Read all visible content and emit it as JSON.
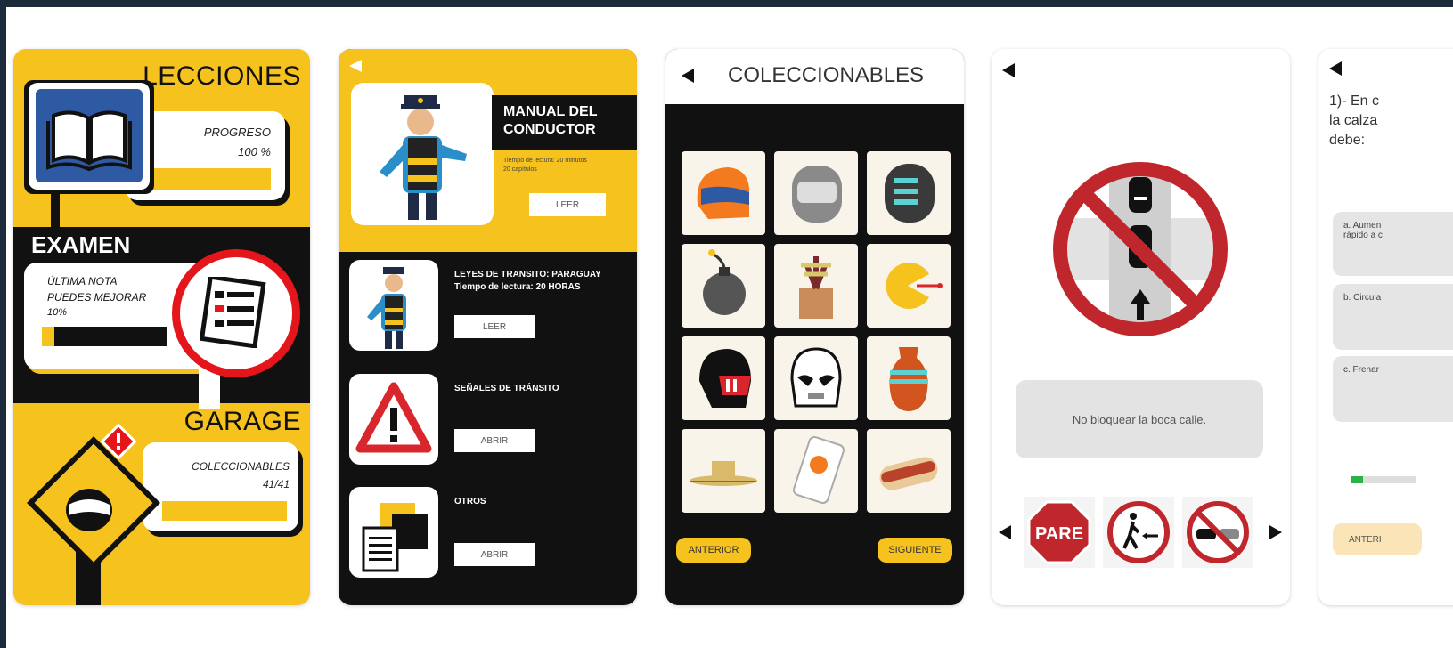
{
  "panel1": {
    "lessons_title": "LECCIONES",
    "progress_label": "PROGRESO",
    "progress_value": "100 %",
    "progress_fraction": 1.0,
    "exam_title": "EXAMEN",
    "last_grade_label": "ÚLTIMA  NOTA",
    "improve_label": "PUEDES MEJORAR",
    "grade_value": "10%",
    "grade_fraction": 0.1,
    "garage_title": "GARAGE",
    "collectibles_label": "COLECCIONABLES",
    "collectibles_value": "41/41",
    "collectibles_fraction": 1.0
  },
  "panel2": {
    "manual_title_line1": "MANUAL DEL",
    "manual_title_line2": "CONDUCTOR",
    "manual_meta_line1": "Tiempo de lectura: 20 minutos",
    "manual_meta_line2": "20 capítulos",
    "read_label": "LEER",
    "law_title": "LEYES DE TRANSITO: PARAGUAY",
    "law_time": "Tiempo de lectura: 20 HORAS",
    "law_button": "LEER",
    "signs_title": "SEÑALES DE TRÁNSITO",
    "signs_button": "ABRIR",
    "others_title": "OTROS",
    "others_button": "ABRIR"
  },
  "panel3": {
    "title": "COLECCIONABLES",
    "prev_label": "ANTERIOR",
    "next_label": "SIGUIENTE",
    "items": [
      "helmet-orange",
      "helmet-gray",
      "helmet-stripes",
      "bomb",
      "plant-pot",
      "pacman",
      "helmet-red",
      "stormtrooper",
      "vase",
      "sombrero",
      "phone-case",
      "hotdog"
    ]
  },
  "panel4": {
    "caption": "No bloquear la boca calle.",
    "signs": [
      "PARE",
      "pedestrian-prohibited",
      "no-overtaking"
    ]
  },
  "panel5": {
    "question_line1": "1)- En c",
    "question_line2": "la calza",
    "question_line3": "debe:",
    "option_a_line1": "a. Aumen",
    "option_a_line2": "rápido a c",
    "option_b": "b. Circula",
    "option_c": "c. Frenar",
    "prev_label": "ANTERI"
  },
  "colors": {
    "yellow": "#f6c21e",
    "black": "#111111",
    "navy_frame": "#1c2b3b",
    "stop_red": "#c0272d"
  }
}
